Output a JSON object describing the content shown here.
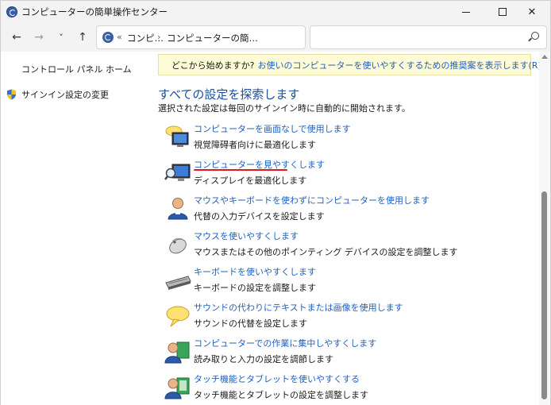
{
  "window": {
    "title": "コンピューターの簡単操作センター",
    "minimize": "",
    "maximize": "",
    "close": "✕"
  },
  "nav": {
    "back": "←",
    "forward": "→",
    "recent": "˅",
    "up": "↑",
    "breadcrumb": [
      "コンピ…",
      "コンピューターの簡…"
    ],
    "separator_start": "«",
    "separator": "›",
    "dropdown": "˅",
    "refresh": "↻",
    "search_placeholder": ""
  },
  "sidebar": {
    "home_link": "コントロール パネル ホーム",
    "signin_link": "サインイン設定の変更"
  },
  "tip": {
    "text": "どこから始めますか?",
    "link": "お使いのコンピューターを使いやすくするための推奨案を表示します(R)"
  },
  "main": {
    "title": "すべての設定を探索します",
    "description": "選択された設定は毎回のサインイン時に自動的に開始されます。",
    "items": [
      {
        "label": "コンピューターを画面なしで使用します",
        "desc": "視覚障碍者向けに最適化します",
        "icon": "monitor-speech-icon"
      },
      {
        "label": "コンピューターを見やすくします",
        "desc": "ディスプレイを最適化します",
        "icon": "magnifier-monitor-icon"
      },
      {
        "label": "マウスやキーボードを使わずにコンピューターを使用します",
        "desc": "代替の入力デバイスを設定します",
        "icon": "user-icon"
      },
      {
        "label": "マウスを使いやすくします",
        "desc": "マウスまたはその他のポインティング デバイスの設定を調整します",
        "icon": "mouse-icon"
      },
      {
        "label": "キーボードを使いやすくします",
        "desc": "キーボードの設定を調整します",
        "icon": "keyboard-icon"
      },
      {
        "label": "サウンドの代わりにテキストまたは画像を使用します",
        "desc": "サウンドの代替を設定します",
        "icon": "speech-bubble-icon"
      },
      {
        "label": "コンピューターでの作業に集中しやすくします",
        "desc": "読み取りと入力の設定を調節します",
        "icon": "user-book-icon"
      },
      {
        "label": "タッチ機能とタブレットを使いやすくする",
        "desc": "タッチ機能とタブレットの設定を調整します",
        "icon": "user-tablet-icon"
      }
    ]
  },
  "colors": {
    "link": "#1f5fbf",
    "heading": "#1a4e9c",
    "highlight_underline": "#e0191f",
    "tip_background": "#fffbd6"
  }
}
